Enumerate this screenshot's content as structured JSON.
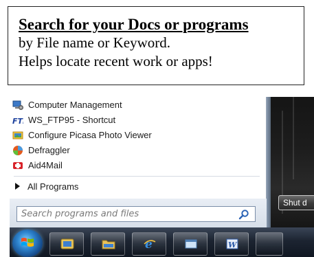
{
  "callout": {
    "headline": "Search for your Docs or programs",
    "line1": "by File name or Keyword.",
    "line2": "Helps locate recent work or apps!"
  },
  "start_menu": {
    "programs": [
      {
        "label": "Computer Management",
        "icon": "computer-management-icon"
      },
      {
        "label": "WS_FTP95 - Shortcut",
        "icon": "ftp-icon"
      },
      {
        "label": "Configure Picasa Photo Viewer",
        "icon": "picasa-icon"
      },
      {
        "label": "Defraggler",
        "icon": "defraggler-icon"
      },
      {
        "label": "Aid4Mail",
        "icon": "aid4mail-icon"
      }
    ],
    "all_programs": "All Programs",
    "search": {
      "placeholder": "Search programs and files",
      "icon": "search-icon"
    },
    "shutdown": "Shut d"
  },
  "taskbar": {
    "items": [
      {
        "icon": "start-orb-icon"
      },
      {
        "icon": "explorer-window-icon"
      },
      {
        "icon": "folder-icon"
      },
      {
        "icon": "internet-explorer-icon"
      },
      {
        "icon": "window-icon"
      },
      {
        "icon": "word-icon"
      }
    ]
  },
  "colors": {
    "taskbar": "#1c2431",
    "search_border": "#7b8ea8",
    "callout_border": "#222222"
  }
}
